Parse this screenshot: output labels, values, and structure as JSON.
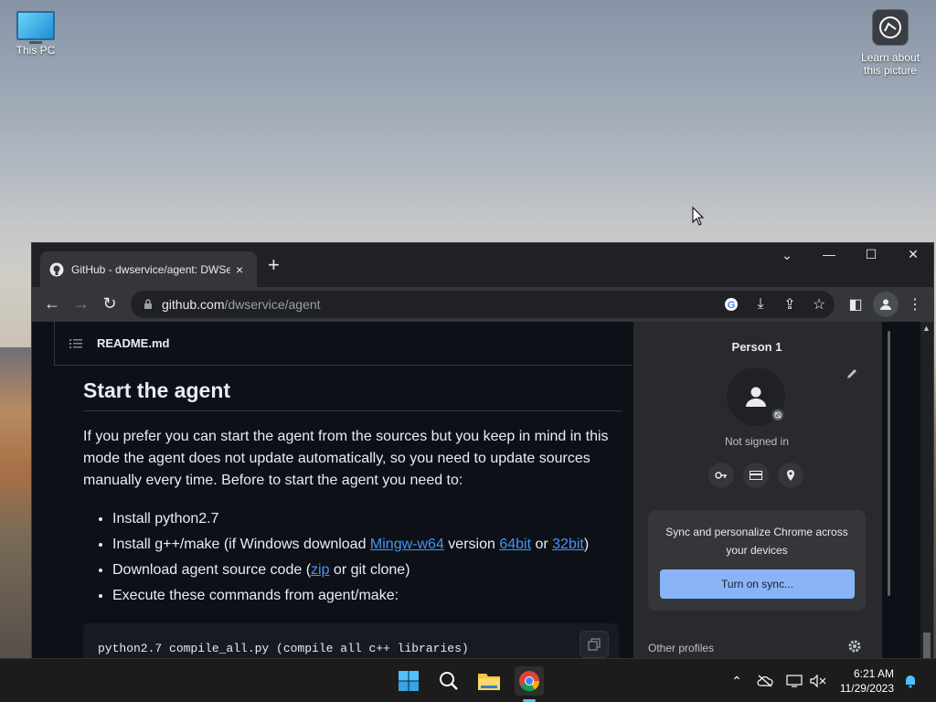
{
  "desktop": {
    "this_pc_label": "This PC",
    "learn_label_1": "Learn about",
    "learn_label_2": "this picture"
  },
  "browser": {
    "tab_title": "GitHub - dwservice/agent: DWSe",
    "tab_close": "×",
    "new_tab": "+",
    "url_host": "github.com",
    "url_path": "/dwservice/agent",
    "win_dropdown": "⌄",
    "win_minimize": "—",
    "win_maximize": "☐",
    "win_close": "✕"
  },
  "readme": {
    "file_name": "README.md",
    "heading": "Start the agent",
    "intro": "If you prefer you can start the agent from the sources but you keep in mind in this mode the agent does not update automatically, so you need to update sources manually every time. Before to start the agent you need to:",
    "items": {
      "item1": "Install python2.7",
      "item2_pre": "Install g++/make (if Windows download ",
      "item2_link1": "Mingw-w64",
      "item2_mid1": " version ",
      "item2_link2": "64bit",
      "item2_mid2": " or ",
      "item2_link3": "32bit",
      "item2_post": ")",
      "item3_pre": "Download agent source code (",
      "item3_link": "zip",
      "item3_post": " or git clone)",
      "item4": "Execute these commands from agent/make:"
    },
    "code_line": "python2.7 compile_all.py (compile all c++ libraries)"
  },
  "profile_panel": {
    "name": "Person 1",
    "status": "Not signed in",
    "sync_text": "Sync and personalize Chrome across your devices",
    "sync_button": "Turn on sync...",
    "other_profiles": "Other profiles"
  },
  "taskbar": {
    "time": "6:21 AM",
    "date": "11/29/2023"
  },
  "colors": {
    "accent": "#8ab4f8",
    "link": "#4493f8",
    "page_bg": "#0d1117"
  }
}
